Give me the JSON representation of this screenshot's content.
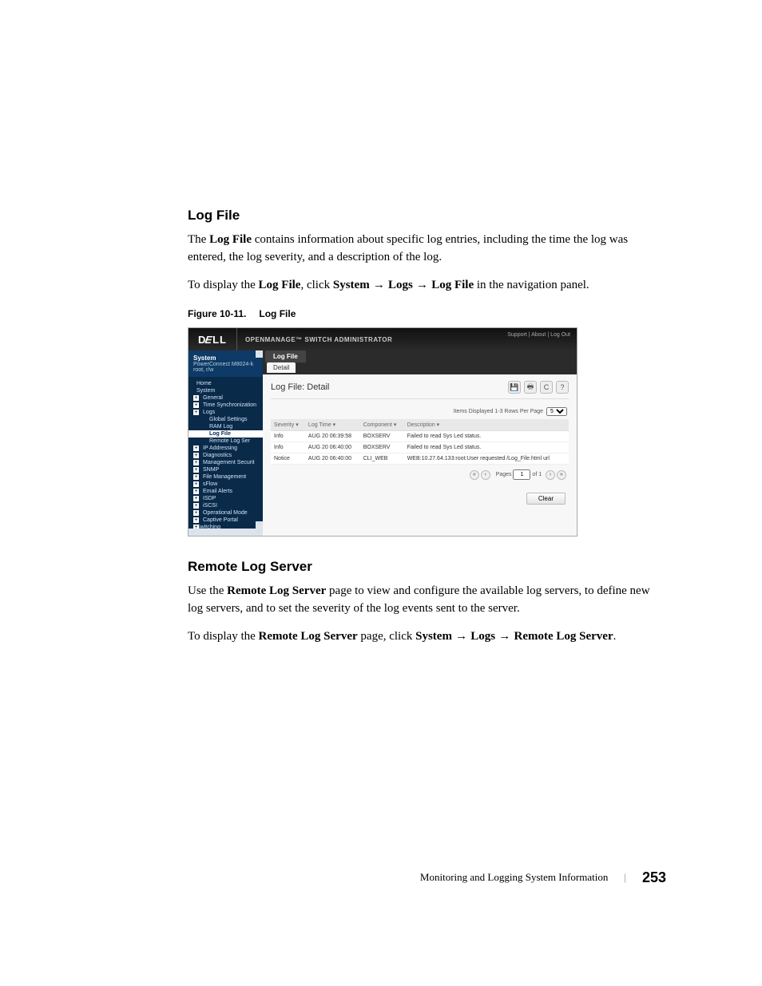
{
  "section1": {
    "heading": "Log File",
    "para1_pre": "The ",
    "para1_bold": "Log File",
    "para1_post": " contains information about specific log entries, including the time the log was entered, the log severity, and a description of the log.",
    "para2_pre": "To display the ",
    "para2_b1": "Log File",
    "para2_mid1": ", click ",
    "para2_b2": "System",
    "para2_b3": "Logs",
    "para2_b4": "Log File",
    "para2_post": " in the navigation panel."
  },
  "figure": {
    "label": "Figure 10-11.",
    "title": "Log File",
    "app": {
      "brand": "DELL",
      "product": "OPENMANAGE™ SWITCH ADMINISTRATOR",
      "top_links": "Support  |  About  |  Log Out",
      "system_label": "System",
      "system_sub": "PowerConnect M8024-k",
      "user": "root, r/w",
      "tree": [
        {
          "lvl": "l1",
          "label": "Home"
        },
        {
          "lvl": "l1",
          "label": "System"
        },
        {
          "lvl": "l2 exp",
          "label": "General"
        },
        {
          "lvl": "l2 exp",
          "label": "Time Synchronization"
        },
        {
          "lvl": "l2 exp",
          "label": "Logs"
        },
        {
          "lvl": "l3",
          "label": "Global Settings"
        },
        {
          "lvl": "l3",
          "label": "RAM Log"
        },
        {
          "lvl": "l3 act",
          "label": "Log File"
        },
        {
          "lvl": "l3",
          "label": "Remote Log Ser"
        },
        {
          "lvl": "l2 exp",
          "label": "IP Addressing"
        },
        {
          "lvl": "l2 exp",
          "label": "Diagnostics"
        },
        {
          "lvl": "l2 exp",
          "label": "Management Securit"
        },
        {
          "lvl": "l2 exp",
          "label": "SNMP"
        },
        {
          "lvl": "l2 exp",
          "label": "File Management"
        },
        {
          "lvl": "l2 exp",
          "label": "sFlow"
        },
        {
          "lvl": "l2 exp",
          "label": "Email Alerts"
        },
        {
          "lvl": "l2 exp",
          "label": "ISDP"
        },
        {
          "lvl": "l2 exp",
          "label": "iSCSI"
        },
        {
          "lvl": "l2 exp",
          "label": "Operational Mode"
        },
        {
          "lvl": "l2 exp",
          "label": "Captive Portal"
        },
        {
          "lvl": "l1 exp",
          "label": "Switching"
        }
      ],
      "tab1": "Log File",
      "tab2": "Detail",
      "pane_title": "Log File: Detail",
      "items_displayed": "Items Displayed 1-3   Rows Per Page",
      "rows_per_page": "5",
      "columns": [
        "Severity",
        "Log Time",
        "Component",
        "Description"
      ],
      "rows": [
        {
          "sev": "Info",
          "time": "AUG 20 06:39:58",
          "comp": "BOXSERV",
          "desc": "Failed to read Sys Led status."
        },
        {
          "sev": "Info",
          "time": "AUG 20 06:40:00",
          "comp": "BOXSERV",
          "desc": "Failed to read Sys Led status."
        },
        {
          "sev": "Notice",
          "time": "AUG 20 06:40:00",
          "comp": "CLI_WEB",
          "desc": "WEB:10.27.64.133:root:User requested /Log_File.html url"
        }
      ],
      "pager_pages_label": "Pages",
      "pager_current": "1",
      "pager_of": "of 1",
      "clear_label": "Clear"
    }
  },
  "section2": {
    "heading": "Remote Log Server",
    "para1_pre": "Use the ",
    "para1_bold": "Remote Log Server",
    "para1_post": " page to view and configure the available log servers, to define new log servers, and to set the severity of the log events sent to the server.",
    "para2_pre": "To display the ",
    "para2_b1": "Remote Log Server",
    "para2_mid1": " page, click ",
    "para2_b2": "System",
    "para2_b3": "Logs",
    "para2_b4": "Remote Log Server",
    "para2_post": "."
  },
  "footer": {
    "text": "Monitoring and Logging System Information",
    "page": "253"
  }
}
